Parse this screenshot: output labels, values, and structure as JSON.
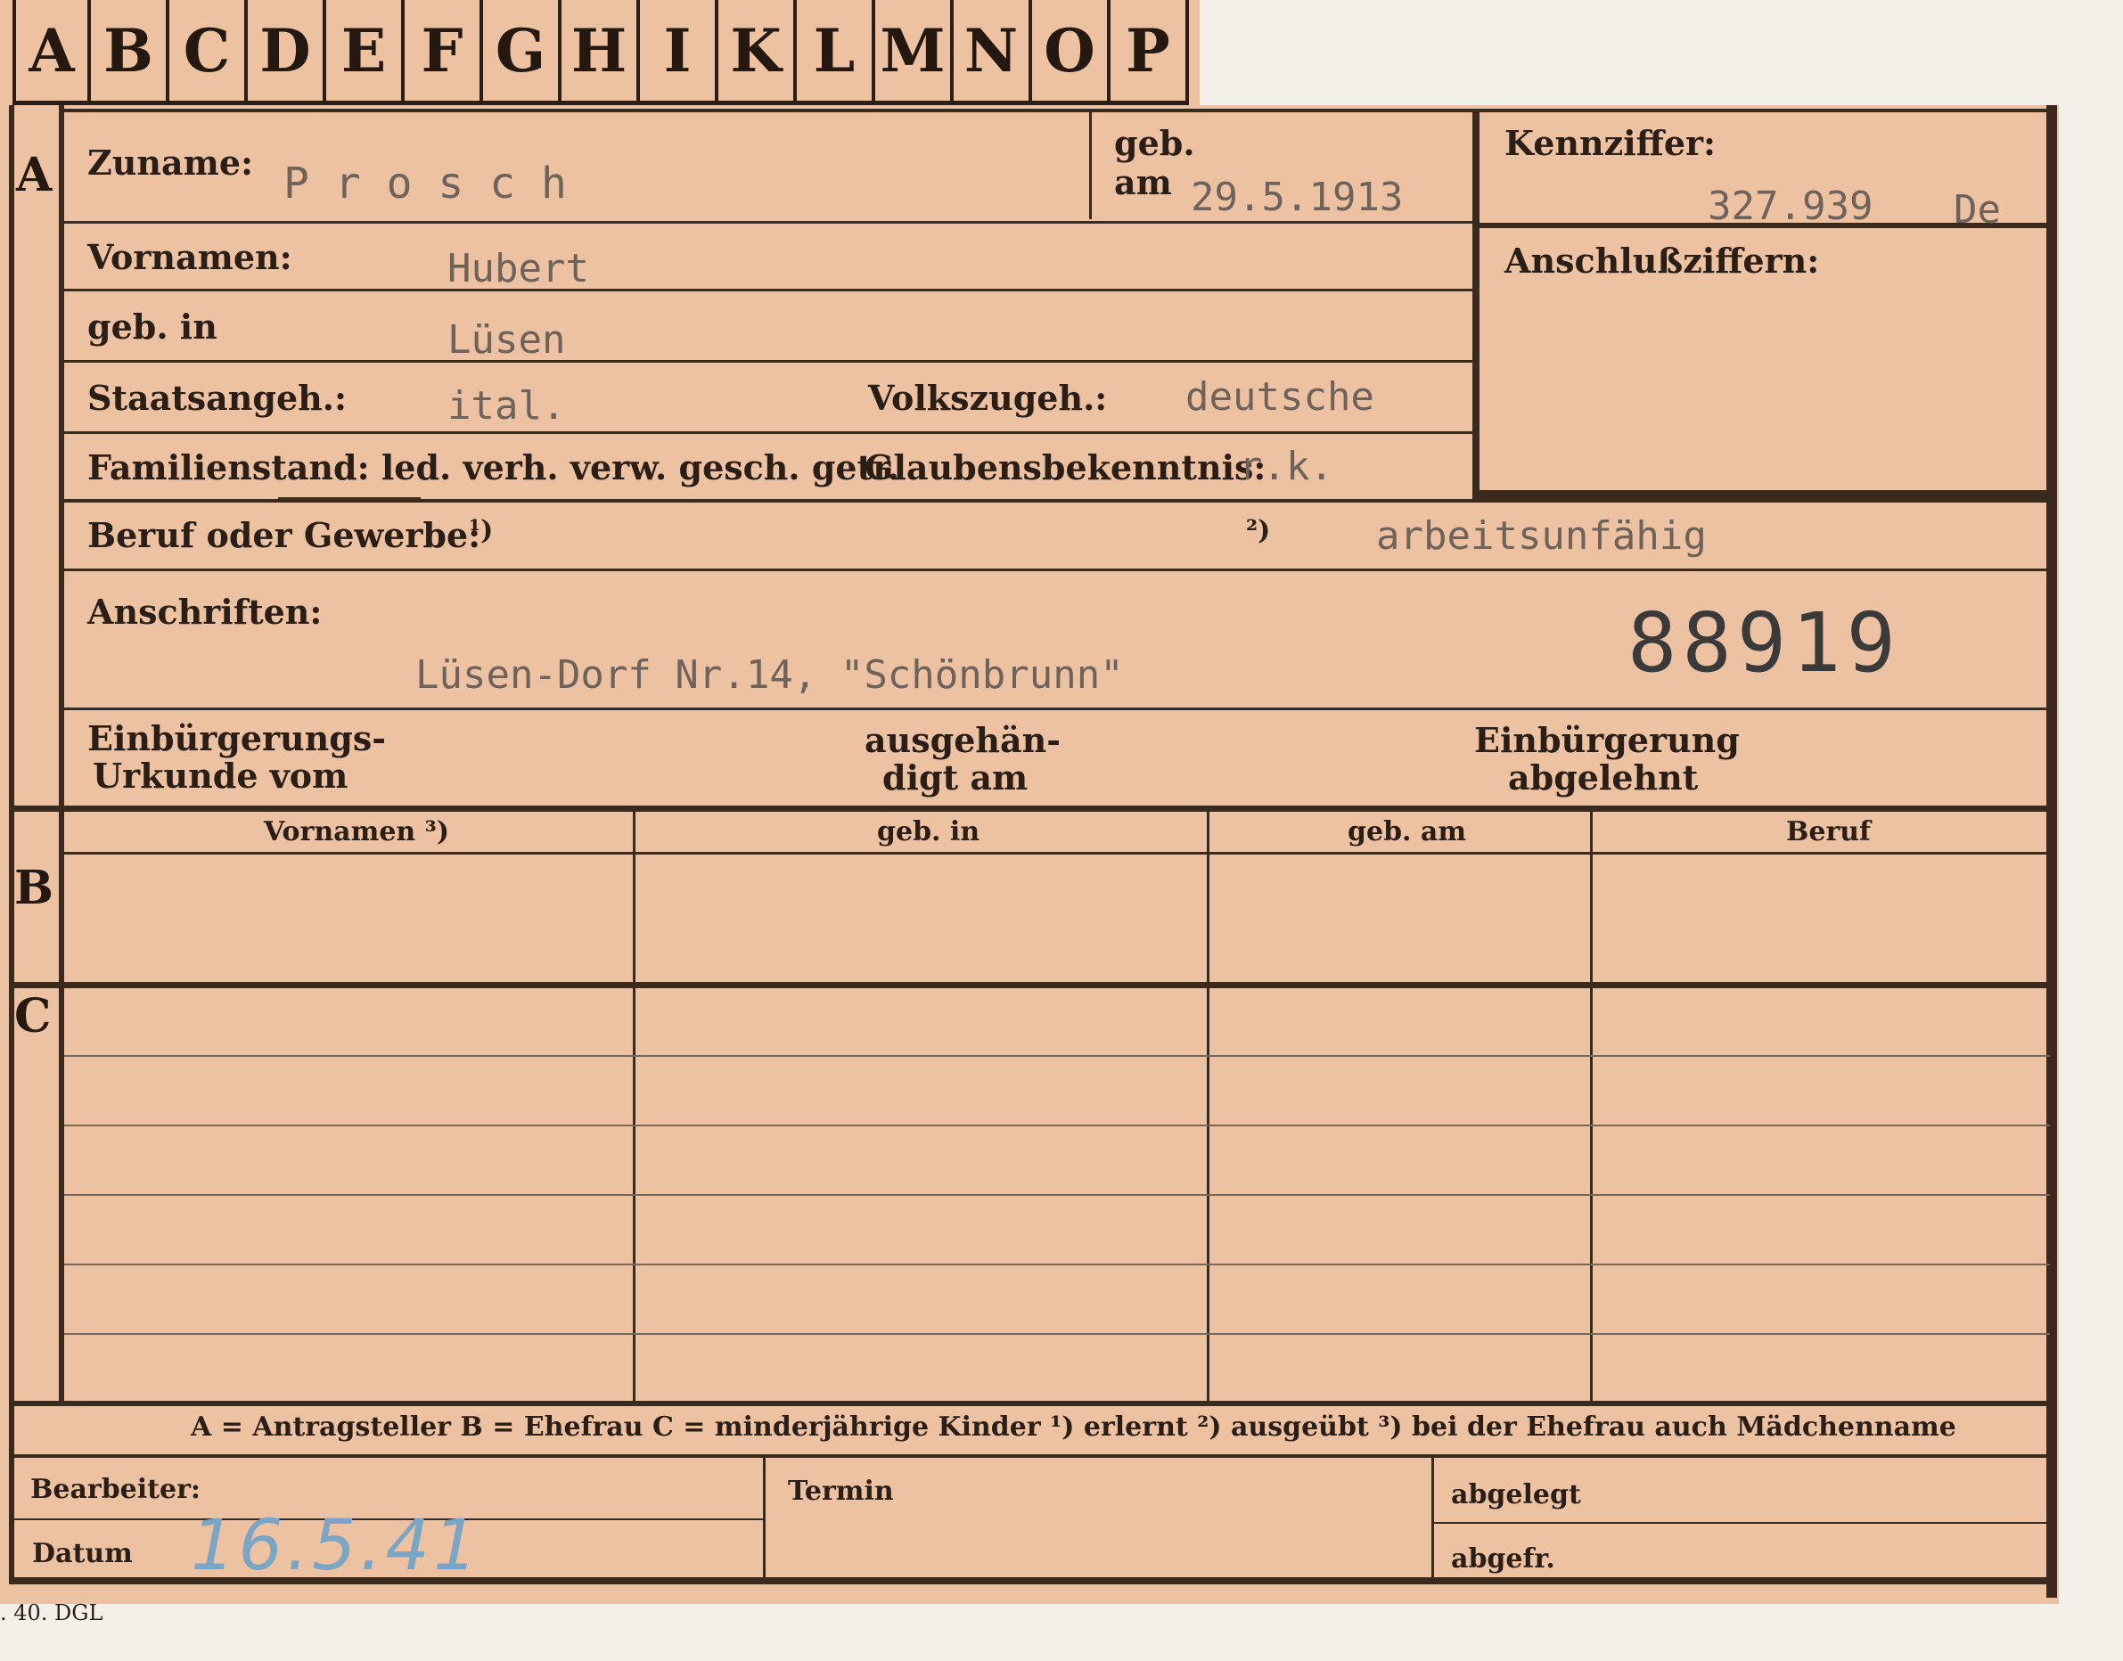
{
  "alphabet_tabs": [
    "A",
    "B",
    "C",
    "D",
    "E",
    "F",
    "G",
    "H",
    "I",
    "K",
    "L",
    "M",
    "N",
    "O",
    "P"
  ],
  "sections": {
    "a": "A",
    "b": "B",
    "c": "C"
  },
  "person": {
    "surname_label": "Zuname:",
    "surname": "P r o s c h",
    "born_label_1": "geb.",
    "born_label_2": "am",
    "born_date": "29.5.1913",
    "firstnames_label": "Vornamen:",
    "firstnames": "Hubert",
    "birthplace_label": "geb. in",
    "birthplace": "Lüsen",
    "citizenship_label": "Staatsangeh.:",
    "citizenship": "ital.",
    "ethnicity_label": "Volkszugeh.:",
    "ethnicity": "deutsche",
    "marital_label": "Familienstand: led. verh. verw. gesch. getr.",
    "religion_label": "Glaubensbekenntnis:",
    "religion": "r.k.",
    "profession_label": "Beruf oder Gewerbe:",
    "note1": "¹)",
    "note2": "²)",
    "profession": "arbeitsunfähig",
    "address_label": "Anschriften:",
    "address": "Lüsen-Dorf Nr.14, \"Schönbrunn\"",
    "stamp_number": "88919",
    "naturalization_doc_label_1": "Einbürgerungs-",
    "naturalization_doc_label_2": "Urkunde vom",
    "handed_label_1": "ausgehän-",
    "handed_label_2": "digt am",
    "naturalization_denied_label_1": "Einbürgerung",
    "naturalization_denied_label_2": "abgelehnt"
  },
  "reference": {
    "kennziffer_label": "Kennziffer:",
    "kennziffer": "327.939",
    "kennziffer_suffix": "De",
    "anschluss_label": "Anschlußziffern:"
  },
  "family_table": {
    "headers": [
      "Vornamen ³)",
      "geb. in",
      "geb. am",
      "Beruf"
    ]
  },
  "legend": "A = Antragsteller   B = Ehefrau   C = minderjährige Kinder   ¹) erlernt   ²) ausgeübt   ³) bei der Ehefrau auch Mädchenname",
  "footer": {
    "processor_label": "Bearbeiter:",
    "date_label": "Datum",
    "date_value": "16.5.41",
    "termin_label": "Termin",
    "filed_label": "abgelegt",
    "sent_label": "abgefr.",
    "print_mark": ". 40. DGL"
  }
}
